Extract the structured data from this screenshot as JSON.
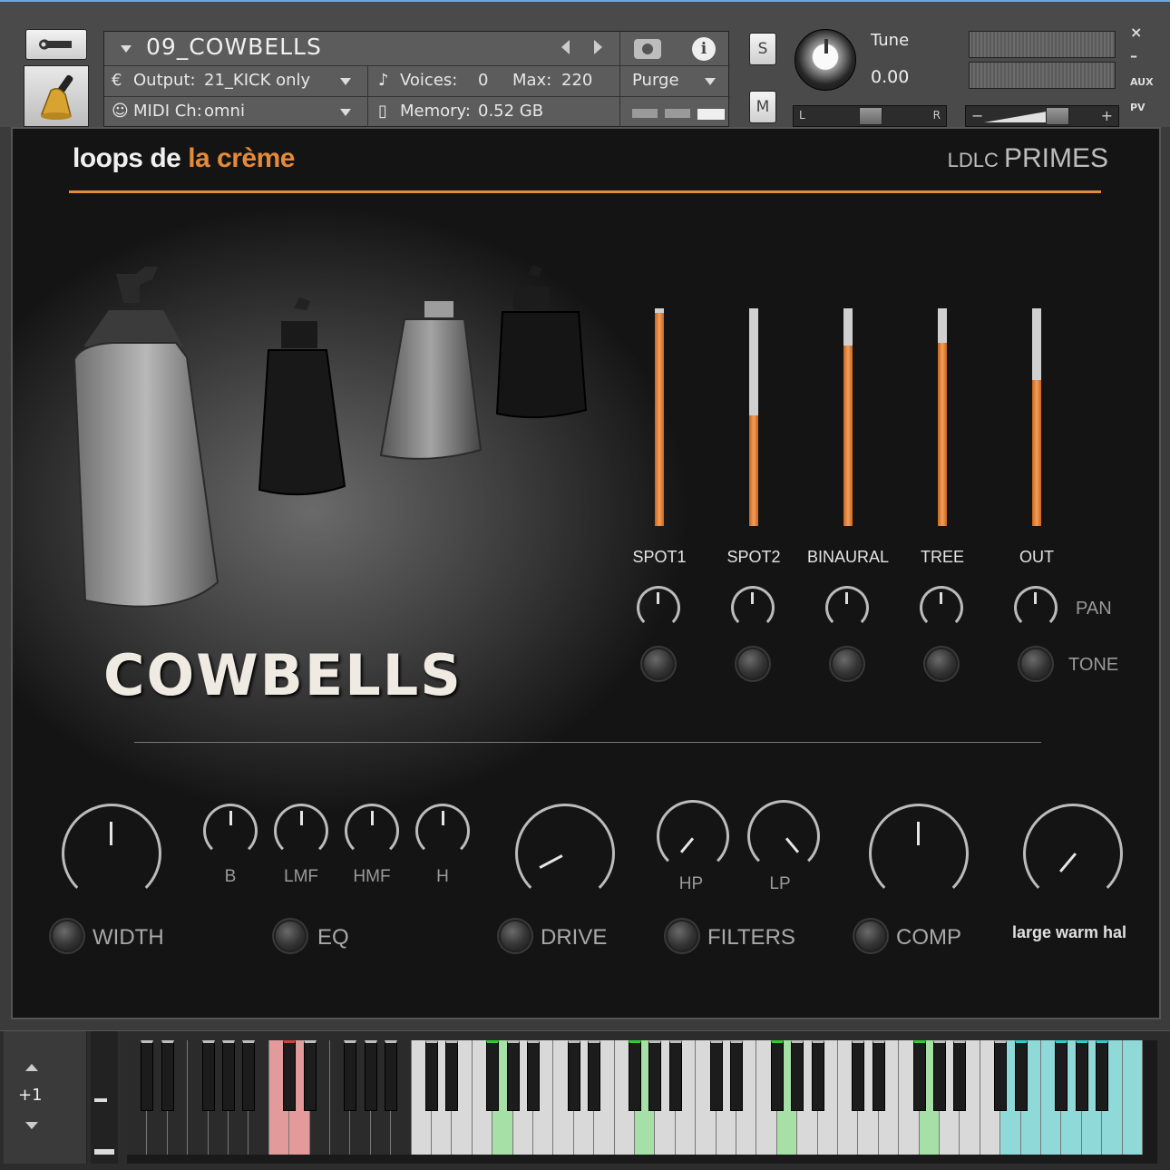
{
  "header": {
    "instrument_name": "09_COWBELLS",
    "output_label": "Output:",
    "output_value": "21_KICK only",
    "midi_label": "MIDI Ch:",
    "midi_value": "omni",
    "voices_label": "Voices:",
    "voices_value": "0",
    "max_label": "Max:",
    "max_value": "220",
    "memory_label": "Memory:",
    "memory_value": "0.52 GB",
    "purge_label": "Purge",
    "solo_label": "S",
    "mute_label": "M",
    "tune_label": "Tune",
    "tune_value": "0.00",
    "pan_left": "L",
    "pan_right": "R",
    "vol_minus": "−",
    "vol_plus": "+",
    "close": "×",
    "minimize": "–",
    "aux": "AUX",
    "pv": "PV"
  },
  "panel": {
    "brand_1": "loops de ",
    "brand_2": "la crème",
    "product_prefix": "LDLC ",
    "product_name": "PRIMES",
    "instrument_title": "COWBELLS",
    "pan_label": "PAN",
    "tone_label": "TONE",
    "mixer": [
      {
        "name": "SPOT1",
        "level": 0.98
      },
      {
        "name": "SPOT2",
        "level": 0.51
      },
      {
        "name": "BINAURAL",
        "level": 0.83
      },
      {
        "name": "TREE",
        "level": 0.84
      },
      {
        "name": "OUT",
        "level": 0.67
      }
    ],
    "eq_bands": [
      "B",
      "LMF",
      "HMF",
      "H"
    ],
    "filter_labels": [
      "HP",
      "LP"
    ],
    "sections": {
      "width": "WIDTH",
      "eq": "EQ",
      "drive": "DRIVE",
      "filters": "FILTERS",
      "comp": "COMP"
    },
    "reverb_preset": "large warm hal"
  },
  "keyboard": {
    "octave_offset": "+1"
  },
  "colors": {
    "accent": "#e48a3a",
    "key_red": "#e39a9a",
    "key_green": "#a7e0a7",
    "key_cyan": "#8fd9d9"
  }
}
